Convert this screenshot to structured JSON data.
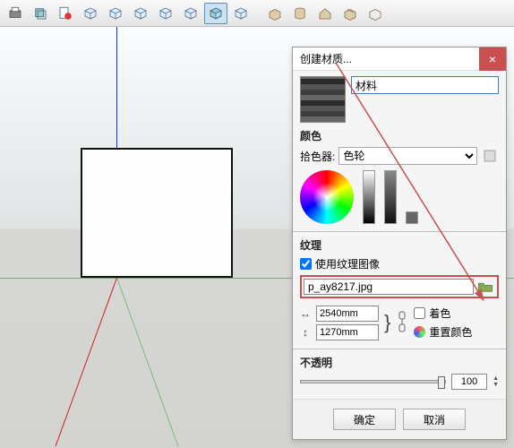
{
  "toolbar": {
    "icons": [
      "printer",
      "box-shadow",
      "file-warning",
      "cube1",
      "cube2",
      "cube3",
      "cube4",
      "cube5",
      "cube-active",
      "cube6",
      "box",
      "folder",
      "house",
      "box2",
      "box3"
    ]
  },
  "dialog": {
    "title": "创建材质...",
    "close": "×",
    "name_value": "材料",
    "color_section": "颜色",
    "picker_label": "拾色器:",
    "picker_value": "色轮",
    "texture_section": "纹理",
    "use_texture_label": "使用纹理图像",
    "use_texture_checked": true,
    "texture_file": "p_ay8217.jpg",
    "width_value": "2540mm",
    "height_value": "1270mm",
    "colorize_label": "着色",
    "reset_color_label": "重置颜色",
    "opacity_section": "不透明",
    "opacity_value": "100",
    "ok_label": "确定",
    "cancel_label": "取消"
  }
}
